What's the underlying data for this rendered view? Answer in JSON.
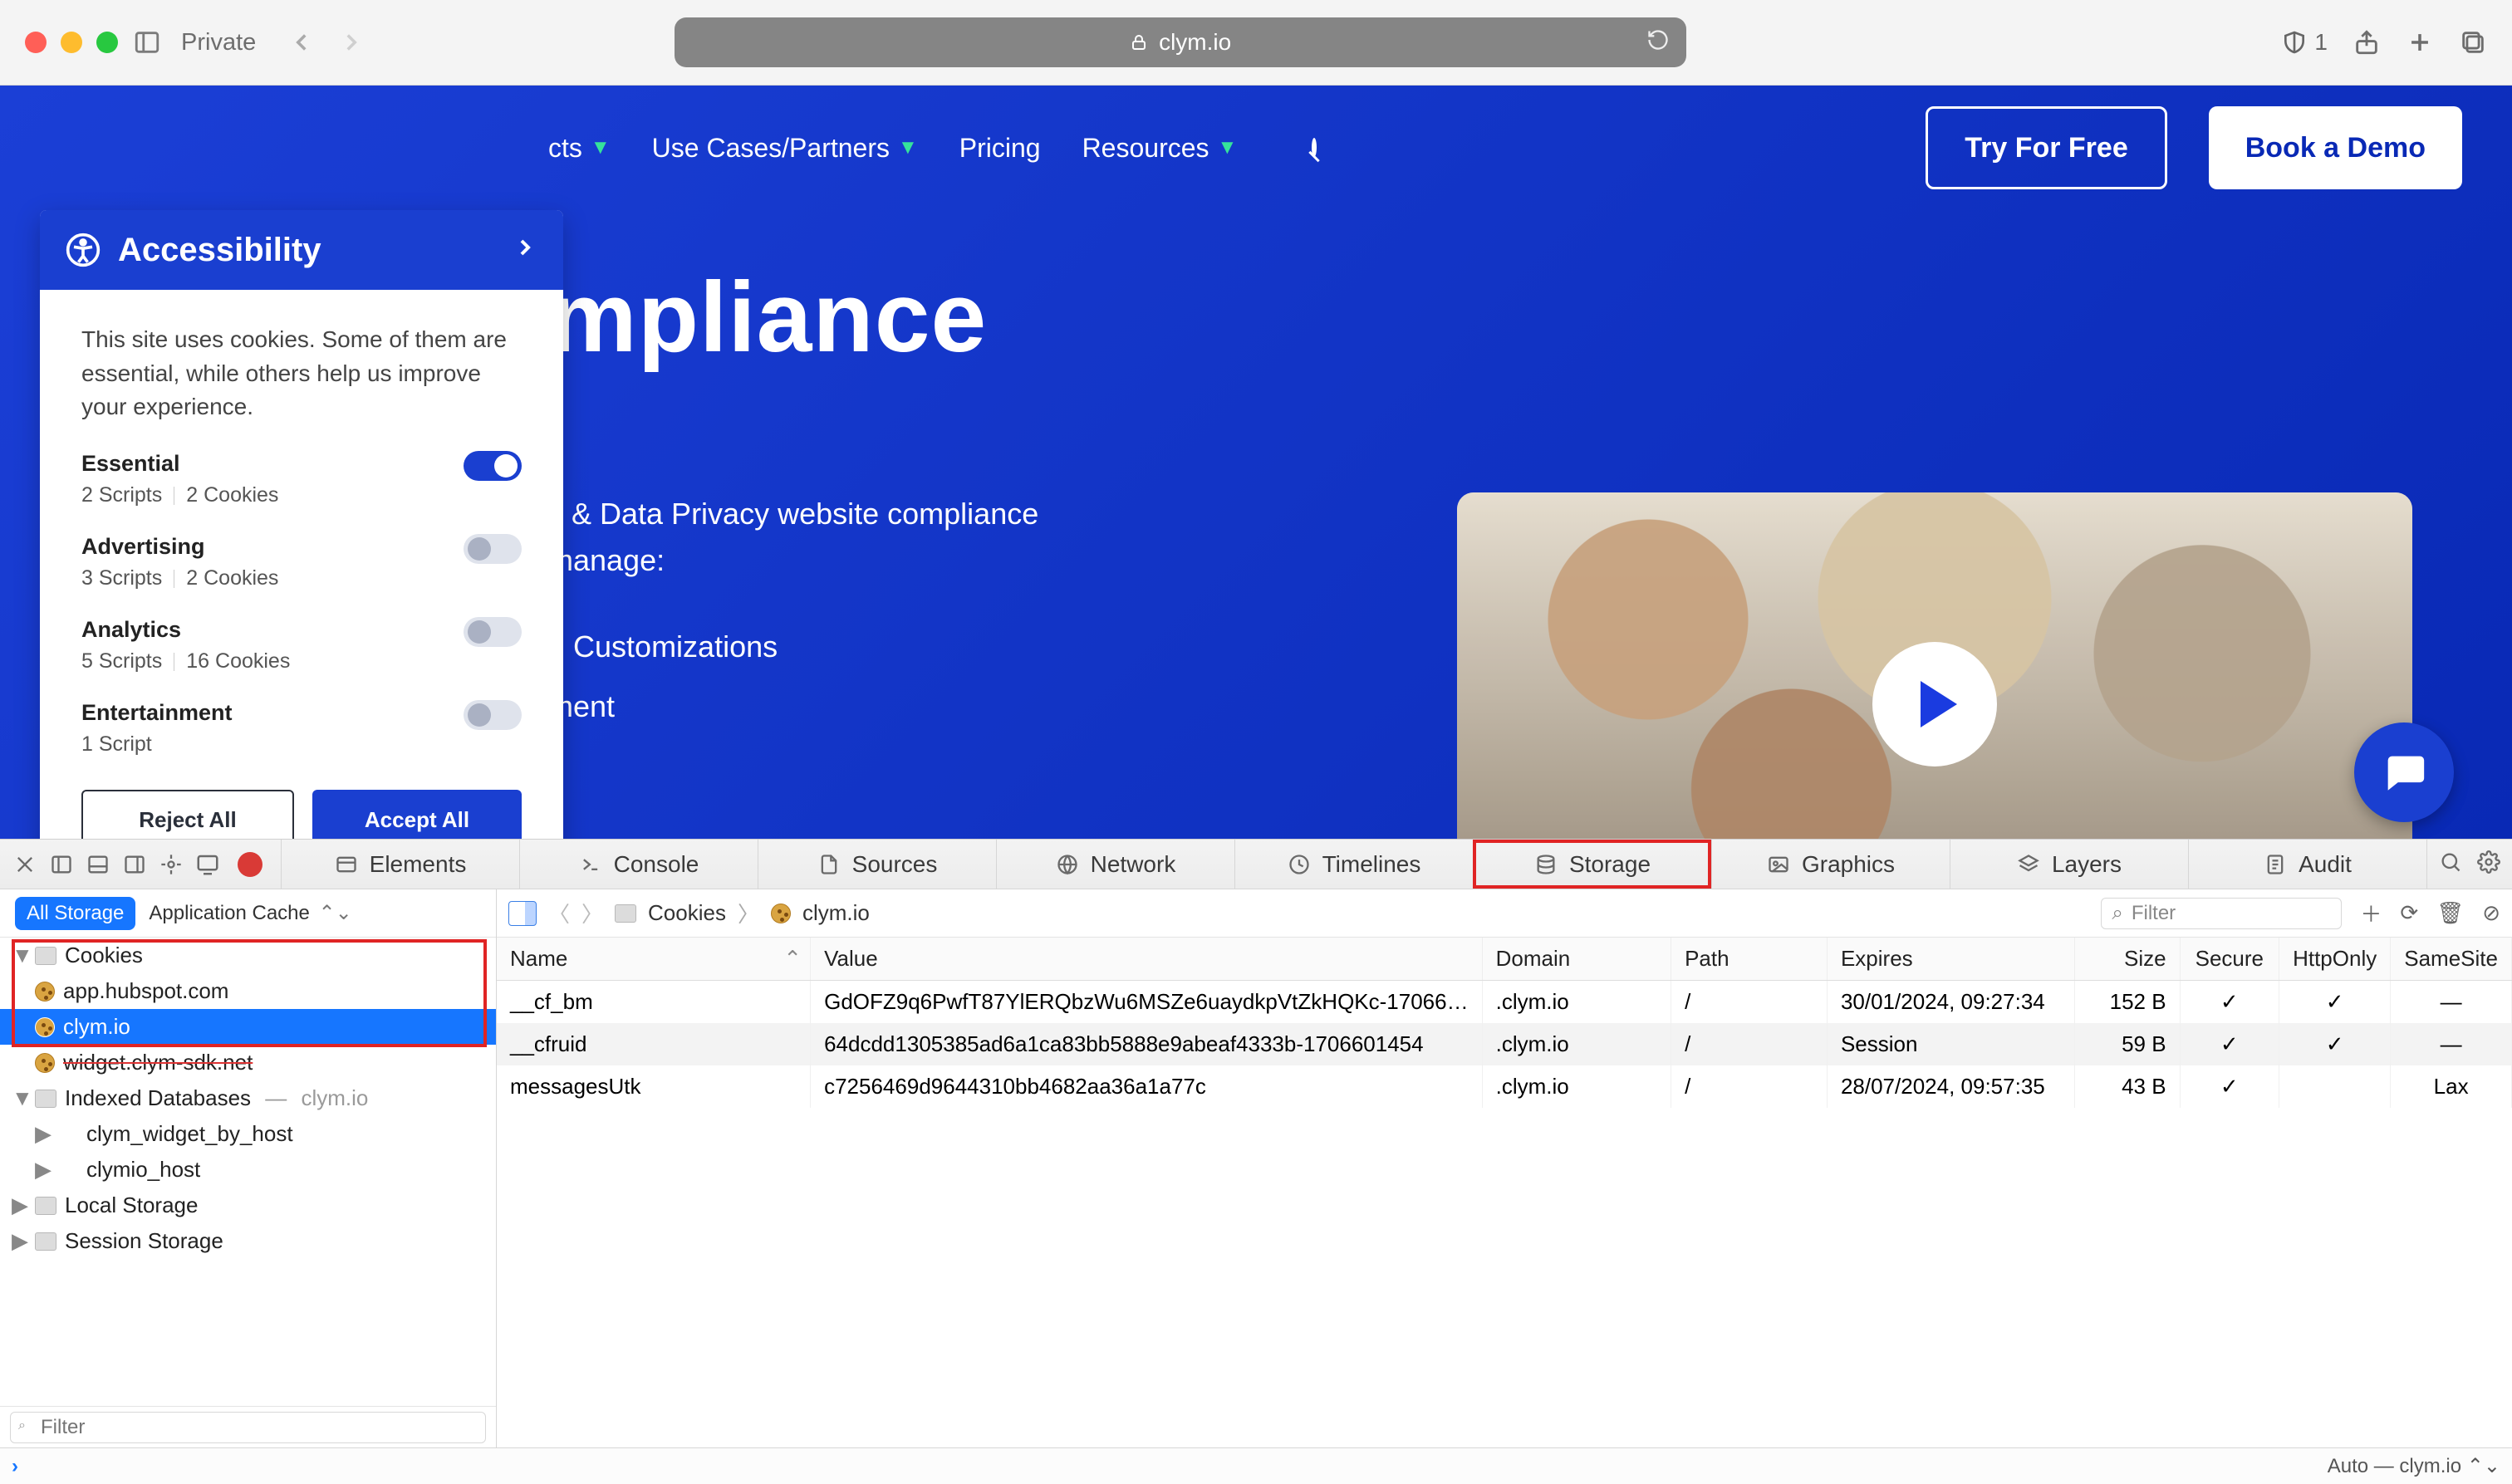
{
  "browser": {
    "private_label": "Private",
    "url": "clym.io",
    "shield_count": "1"
  },
  "site_nav": {
    "items": [
      {
        "label": "cts"
      },
      {
        "label": "Use Cases/Partners"
      },
      {
        "label": "Pricing"
      },
      {
        "label": "Resources"
      }
    ],
    "try_label": "Try For Free",
    "demo_label": "Book a Demo"
  },
  "hero": {
    "title_fragment": "mpliance",
    "sub_line1": "y & Data Privacy website compliance",
    "sub_line2": "manage:",
    "list_item1": "d Customizations",
    "list_item2": "ment"
  },
  "a11y": {
    "title": "Accessibility",
    "desc": "This site uses cookies. Some of them are essential, while others help us improve your experience.",
    "categories": [
      {
        "title": "Essential",
        "scripts": "2 Scripts",
        "cookies": "2 Cookies",
        "on": true
      },
      {
        "title": "Advertising",
        "scripts": "3 Scripts",
        "cookies": "2 Cookies",
        "on": false
      },
      {
        "title": "Analytics",
        "scripts": "5 Scripts",
        "cookies": "16 Cookies",
        "on": false
      },
      {
        "title": "Entertainment",
        "scripts": "1 Script",
        "cookies": "",
        "on": false
      }
    ],
    "reject_label": "Reject All",
    "accept_label": "Accept All"
  },
  "devtools": {
    "tabs": [
      "Elements",
      "Console",
      "Sources",
      "Network",
      "Timelines",
      "Storage",
      "Layers",
      "Graphics",
      "Audit"
    ],
    "sidebar": {
      "all_storage": "All Storage",
      "app_cache": "Application Cache",
      "tree": {
        "cookies_label": "Cookies",
        "cookies_hosts": [
          "app.hubspot.com",
          "clym.io",
          "widget.clym-sdk.net"
        ],
        "indexed_label": "Indexed Databases",
        "indexed_domain": "clym.io",
        "indexed_dbs": [
          "clym_widget_by_host",
          "clymio_host"
        ],
        "local_storage": "Local Storage",
        "session_storage": "Session Storage"
      },
      "filter_placeholder": "Filter"
    },
    "crumb": {
      "folder": "Cookies",
      "host": "clym.io",
      "filter_placeholder": "Filter"
    },
    "table": {
      "headers": [
        "Name",
        "Value",
        "Domain",
        "Path",
        "Expires",
        "Size",
        "Secure",
        "HttpOnly",
        "SameSite"
      ],
      "rows": [
        {
          "name": "__cf_bm",
          "value": "GdOFZ9q6PwfT87YlERQbzWu6MSZe6uaydkpVtZkHQKc-17066…",
          "domain": ".clym.io",
          "path": "/",
          "expires": "30/01/2024, 09:27:34",
          "size": "152 B",
          "secure": "✓",
          "httponly": "✓",
          "samesite": "—"
        },
        {
          "name": "__cfruid",
          "value": "64dcdd1305385ad6a1ca83bb5888e9abeaf4333b-1706601454",
          "domain": ".clym.io",
          "path": "/",
          "expires": "Session",
          "size": "59 B",
          "secure": "✓",
          "httponly": "✓",
          "samesite": "—"
        },
        {
          "name": "messagesUtk",
          "value": "c7256469d9644310bb4682aa36a1a77c",
          "domain": ".clym.io",
          "path": "/",
          "expires": "28/07/2024, 09:57:35",
          "size": "43 B",
          "secure": "✓",
          "httponly": "",
          "samesite": "Lax"
        }
      ]
    },
    "footer_right": "Auto — clym.io"
  }
}
